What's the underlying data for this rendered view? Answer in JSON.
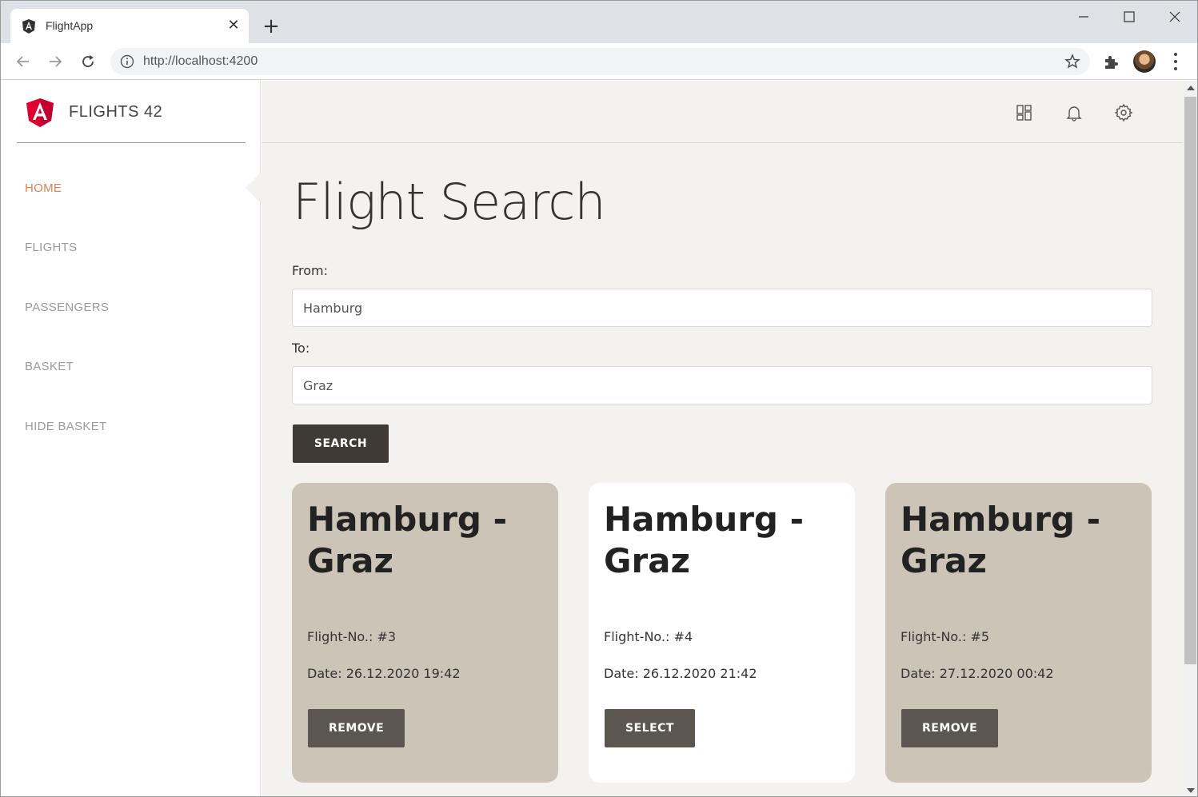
{
  "browser": {
    "tab_title": "FlightApp",
    "url": "http://localhost:4200"
  },
  "sidebar": {
    "brand": "FLIGHTS 42",
    "items": [
      {
        "label": "HOME",
        "active": true
      },
      {
        "label": "FLIGHTS",
        "active": false
      },
      {
        "label": "PASSENGERS",
        "active": false
      },
      {
        "label": "BASKET",
        "active": false
      },
      {
        "label": "HIDE BASKET",
        "active": false
      }
    ]
  },
  "main": {
    "title": "Flight Search",
    "from_label": "From:",
    "from_value": "Hamburg",
    "to_label": "To:",
    "to_value": "Graz",
    "search_label": "SEARCH"
  },
  "flights": [
    {
      "route": "Hamburg - Graz",
      "number": "Flight-No.: #3",
      "date": "Date: 26.12.2020 19:42",
      "action": "REMOVE",
      "selected": true
    },
    {
      "route": "Hamburg - Graz",
      "number": "Flight-No.: #4",
      "date": "Date: 26.12.2020 21:42",
      "action": "SELECT",
      "selected": false
    },
    {
      "route": "Hamburg - Graz",
      "number": "Flight-No.: #5",
      "date": "Date: 27.12.2020 00:42",
      "action": "REMOVE",
      "selected": true
    }
  ],
  "colors": {
    "accent": "#e07f4f",
    "selected_card": "#ccc4b6",
    "dark_button": "#403a34",
    "background": "#f3f2ee"
  }
}
